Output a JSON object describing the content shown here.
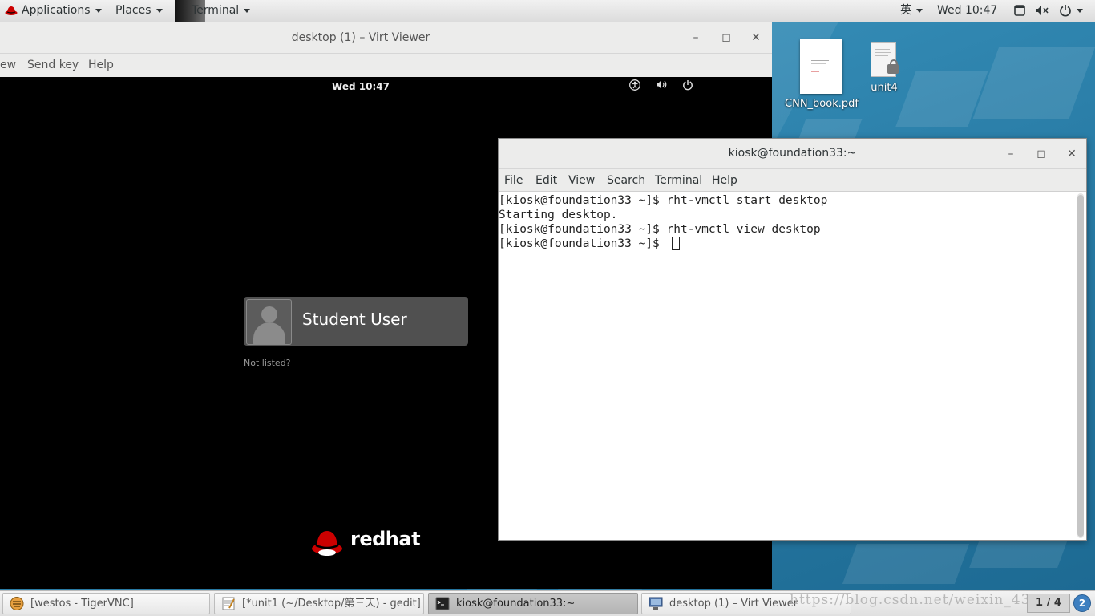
{
  "top_bar": {
    "applications": "Applications",
    "places": "Places",
    "terminal": "Terminal",
    "input_method": "英",
    "clock": "Wed 10:47"
  },
  "virt_viewer": {
    "title": "desktop (1) – Virt Viewer",
    "menus": [
      "ew",
      "Send key",
      "Help"
    ],
    "guest": {
      "clock": "Wed 10:47",
      "user_name": "Student User",
      "not_listed": "Not listed?",
      "brand": "redhat"
    }
  },
  "desktop_icons": [
    {
      "label": "CNN_book.pdf",
      "icon": "pdf-document-icon"
    },
    {
      "label": "unit4",
      "icon": "locked-text-file-icon"
    }
  ],
  "terminal": {
    "title": "kiosk@foundation33:~",
    "menus": [
      "File",
      "Edit",
      "View",
      "Search",
      "Terminal",
      "Help"
    ],
    "lines": [
      "[kiosk@foundation33 ~]$ rht-vmctl start desktop",
      "Starting desktop.",
      "[kiosk@foundation33 ~]$ rht-vmctl view desktop",
      "[kiosk@foundation33 ~]$ "
    ]
  },
  "taskbar": {
    "items": [
      {
        "label": "[westos - TigerVNC]",
        "icon": "tigervnc-icon",
        "active": false
      },
      {
        "label": "[*unit1 (~/Desktop/第三天) - gedit]",
        "icon": "gedit-icon",
        "active": false
      },
      {
        "label": "kiosk@foundation33:~",
        "icon": "terminal-icon",
        "active": true
      },
      {
        "label": "desktop (1) – Virt Viewer",
        "icon": "virt-viewer-icon",
        "active": false
      }
    ],
    "watermark": "https://blog.csdn.net/weixin_43",
    "workspace": "1 / 4",
    "notifications": "2"
  },
  "colors": {
    "desktop_blue": "#2b7fa9",
    "redhat_red": "#cc0000",
    "panel_gray": "#ececeb"
  }
}
